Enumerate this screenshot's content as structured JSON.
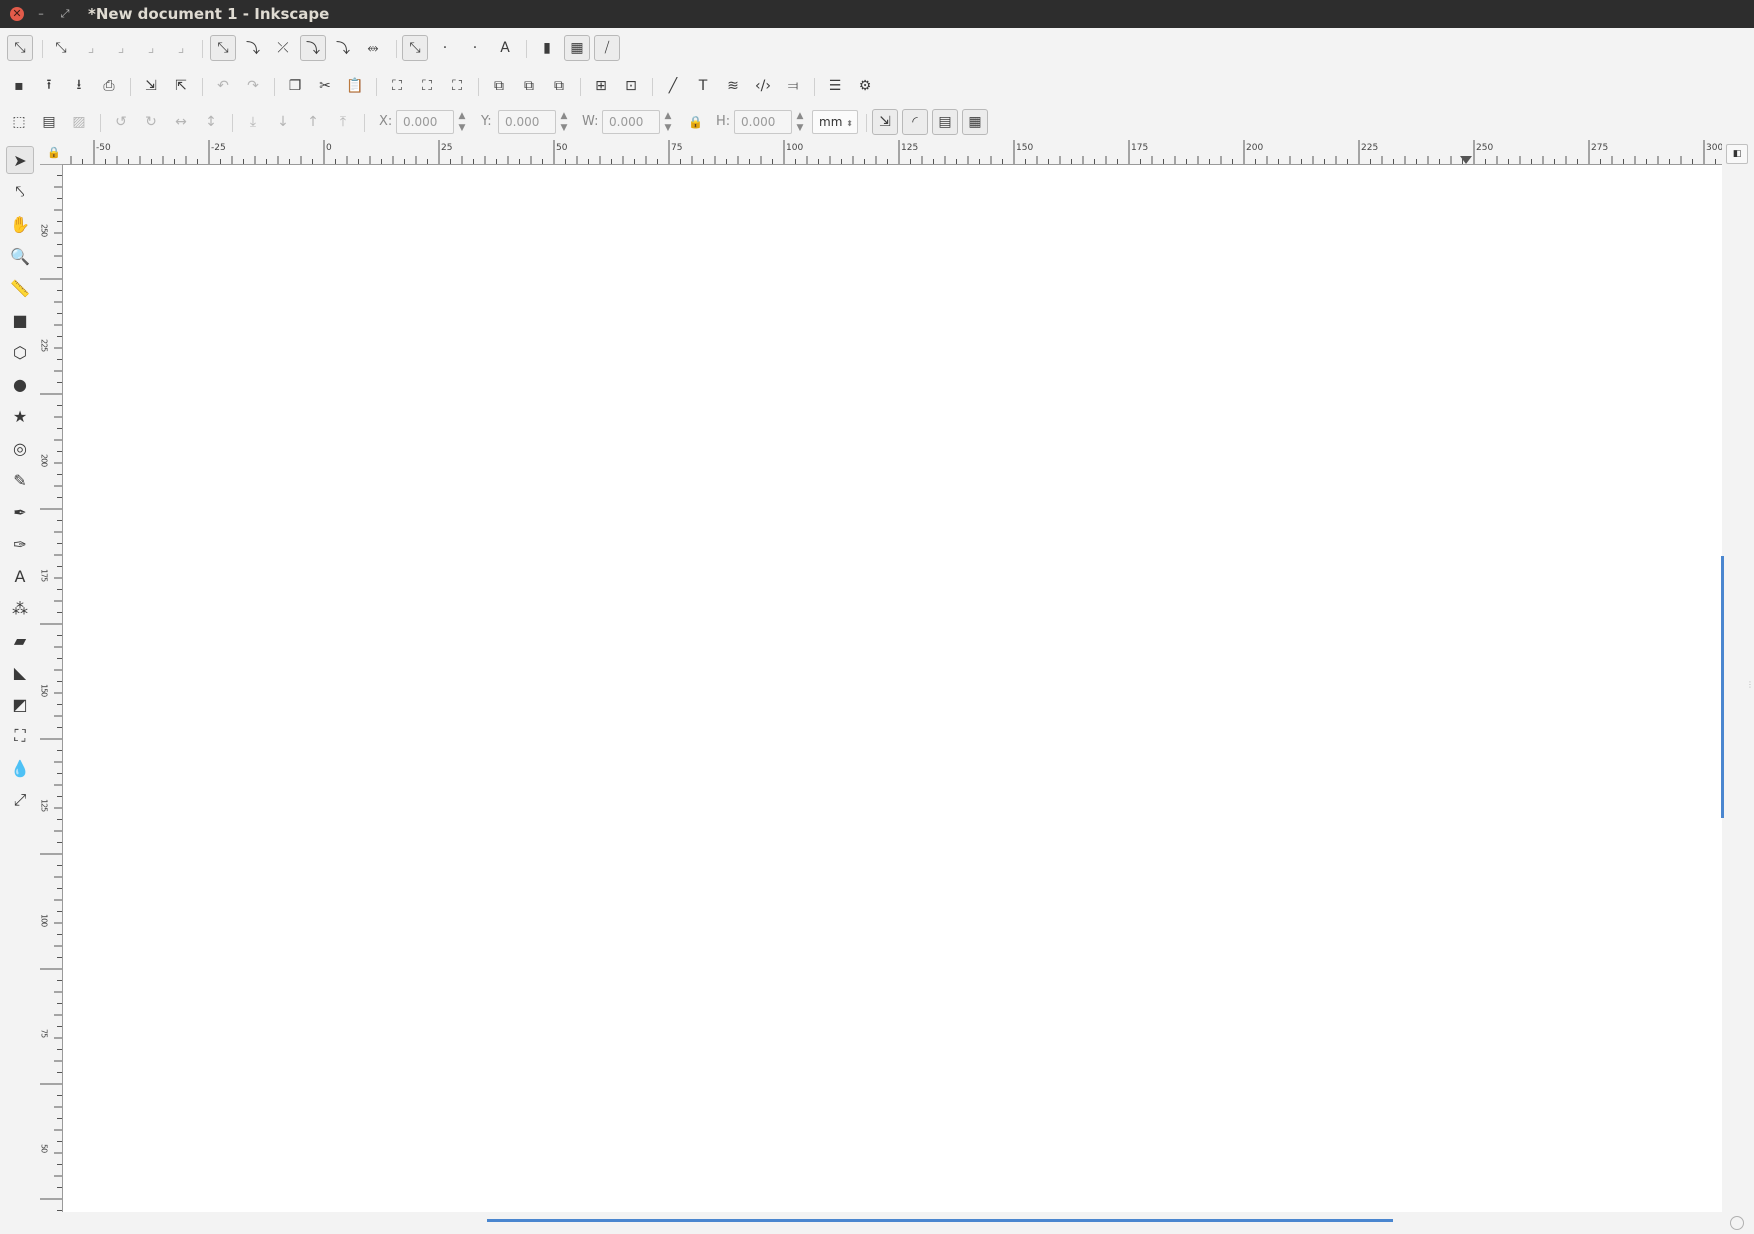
{
  "window": {
    "title": "*New document 1 - Inkscape",
    "close_glyph": "✕",
    "minimize_glyph": "–",
    "maximize_glyph": "⤢"
  },
  "snap_toolbar": {
    "items": [
      {
        "icon": "snap-toggle-icon",
        "glyph": "⤡",
        "pressed": true
      },
      {
        "icon": "snap-bbox-icon",
        "glyph": "⤡",
        "dim": false
      },
      {
        "icon": "snap-bbox-edges-icon",
        "glyph": "⌟",
        "dim": true
      },
      {
        "icon": "snap-bbox-corners-icon",
        "glyph": "⌟",
        "dim": true
      },
      {
        "icon": "snap-bbox-midpoints-icon",
        "glyph": "⌟",
        "dim": true
      },
      {
        "icon": "snap-bbox-centers-icon",
        "glyph": "⌟",
        "dim": true
      },
      {
        "icon": "snap-nodes-icon",
        "glyph": "⤡",
        "pressed": true
      },
      {
        "icon": "snap-paths-icon",
        "glyph": "⤵"
      },
      {
        "icon": "snap-path-intersections-icon",
        "glyph": "⤫"
      },
      {
        "icon": "snap-cusp-nodes-icon",
        "glyph": "⤵",
        "pressed": true
      },
      {
        "icon": "snap-smooth-nodes-icon",
        "glyph": "⤵"
      },
      {
        "icon": "snap-line-midpoints-icon",
        "glyph": "⥈"
      },
      {
        "icon": "snap-others-icon",
        "glyph": "⤡",
        "pressed": true
      },
      {
        "icon": "snap-object-centers-icon",
        "glyph": "·"
      },
      {
        "icon": "snap-rotation-centers-icon",
        "glyph": "·"
      },
      {
        "icon": "snap-text-baseline-icon",
        "glyph": "A"
      },
      {
        "icon": "snap-page-border-icon",
        "glyph": "▮"
      },
      {
        "icon": "snap-grids-icon",
        "glyph": "▦",
        "pressed": true
      },
      {
        "icon": "snap-guides-icon",
        "glyph": "⧸",
        "pressed": true
      }
    ]
  },
  "commands_toolbar": {
    "items": [
      {
        "icon": "new-document-icon",
        "glyph": "▪"
      },
      {
        "icon": "open-icon",
        "glyph": "⭱"
      },
      {
        "icon": "save-icon",
        "glyph": "⭳"
      },
      {
        "icon": "print-icon",
        "glyph": "⎙"
      },
      {
        "icon": "import-icon",
        "glyph": "⇲"
      },
      {
        "icon": "export-icon",
        "glyph": "⇱"
      },
      {
        "icon": "undo-icon",
        "glyph": "↶",
        "dim": true
      },
      {
        "icon": "redo-icon",
        "glyph": "↷",
        "dim": true
      },
      {
        "icon": "copy-icon",
        "glyph": "❐"
      },
      {
        "icon": "cut-icon",
        "glyph": "✂"
      },
      {
        "icon": "paste-icon",
        "glyph": "📋"
      },
      {
        "icon": "zoom-selection-icon",
        "glyph": "⛶"
      },
      {
        "icon": "zoom-drawing-icon",
        "glyph": "⛶"
      },
      {
        "icon": "zoom-page-icon",
        "glyph": "⛶"
      },
      {
        "icon": "duplicate-icon",
        "glyph": "⧉"
      },
      {
        "icon": "clone-icon",
        "glyph": "⧉"
      },
      {
        "icon": "unlink-clone-icon",
        "glyph": "⧉"
      },
      {
        "icon": "group-icon",
        "glyph": "⊞"
      },
      {
        "icon": "ungroup-icon",
        "glyph": "⊡"
      },
      {
        "icon": "fill-stroke-icon",
        "glyph": "╱"
      },
      {
        "icon": "text-font-icon",
        "glyph": "T"
      },
      {
        "icon": "layers-icon",
        "glyph": "≋"
      },
      {
        "icon": "xml-editor-icon",
        "glyph": "‹/›"
      },
      {
        "icon": "align-distribute-icon",
        "glyph": "⫤"
      },
      {
        "icon": "document-properties-icon",
        "glyph": "☰"
      },
      {
        "icon": "preferences-icon",
        "glyph": "⚙"
      }
    ]
  },
  "select_toolbar": {
    "items": [
      {
        "icon": "select-all-icon",
        "glyph": "⬚"
      },
      {
        "icon": "select-all-layers-icon",
        "glyph": "▤"
      },
      {
        "icon": "deselect-icon",
        "glyph": "▨",
        "dim": true
      },
      {
        "icon": "rotate-ccw-icon",
        "glyph": "↺",
        "dim": true
      },
      {
        "icon": "rotate-cw-icon",
        "glyph": "↻",
        "dim": true
      },
      {
        "icon": "flip-horizontal-icon",
        "glyph": "↔",
        "dim": true
      },
      {
        "icon": "flip-vertical-icon",
        "glyph": "↕",
        "dim": true
      },
      {
        "icon": "lower-to-bottom-icon",
        "glyph": "⤓",
        "dim": true
      },
      {
        "icon": "lower-icon",
        "glyph": "↓",
        "dim": true
      },
      {
        "icon": "raise-icon",
        "glyph": "↑",
        "dim": true
      },
      {
        "icon": "raise-to-top-icon",
        "glyph": "⤒",
        "dim": true
      }
    ],
    "x_label": "X:",
    "x_value": "0.000",
    "y_label": "Y:",
    "y_value": "0.000",
    "w_label": "W:",
    "w_value": "0.000",
    "h_label": "H:",
    "h_value": "0.000",
    "unit": "mm",
    "transform_toggles": [
      {
        "icon": "scale-stroke-icon",
        "glyph": "⇲"
      },
      {
        "icon": "scale-radii-icon",
        "glyph": "◜"
      },
      {
        "icon": "move-gradients-icon",
        "glyph": "▤"
      },
      {
        "icon": "move-patterns-icon",
        "glyph": "▦"
      }
    ]
  },
  "toolbox": {
    "tools": [
      {
        "icon": "selector-tool-icon",
        "glyph": "➤",
        "active": true
      },
      {
        "icon": "node-tool-icon",
        "glyph": "⤣"
      },
      {
        "icon": "tweak-tool-icon",
        "glyph": "✋"
      },
      {
        "icon": "zoom-tool-icon",
        "glyph": "🔍"
      },
      {
        "icon": "measure-tool-icon",
        "glyph": "📏"
      },
      {
        "icon": "rectangle-tool-icon",
        "glyph": "■"
      },
      {
        "icon": "3d-box-tool-icon",
        "glyph": "⬡"
      },
      {
        "icon": "ellipse-tool-icon",
        "glyph": "●"
      },
      {
        "icon": "star-tool-icon",
        "glyph": "★"
      },
      {
        "icon": "spiral-tool-icon",
        "glyph": "◎"
      },
      {
        "icon": "pencil-tool-icon",
        "glyph": "✎"
      },
      {
        "icon": "pen-tool-icon",
        "glyph": "✒"
      },
      {
        "icon": "calligraphy-tool-icon",
        "glyph": "✑"
      },
      {
        "icon": "text-tool-icon",
        "glyph": "A"
      },
      {
        "icon": "spray-tool-icon",
        "glyph": "⁂"
      },
      {
        "icon": "eraser-tool-icon",
        "glyph": "▰"
      },
      {
        "icon": "paint-bucket-tool-icon",
        "glyph": "◣"
      },
      {
        "icon": "gradient-tool-icon",
        "glyph": "◩"
      },
      {
        "icon": "mesh-tool-icon",
        "glyph": "⛶"
      },
      {
        "icon": "dropper-tool-icon",
        "glyph": "💧"
      },
      {
        "icon": "connector-tool-icon",
        "glyph": "⤢"
      }
    ]
  },
  "rulers": {
    "horizontal_labels": [
      "-50",
      "-25",
      "0",
      "25",
      "50",
      "75",
      "100",
      "125",
      "150",
      "175",
      "200",
      "225",
      "250",
      "275",
      "300"
    ],
    "vertical_labels": [
      "250",
      "225",
      "200",
      "175",
      "150",
      "125",
      "100",
      "75",
      "50"
    ]
  },
  "accent_color": "#4a86cf"
}
